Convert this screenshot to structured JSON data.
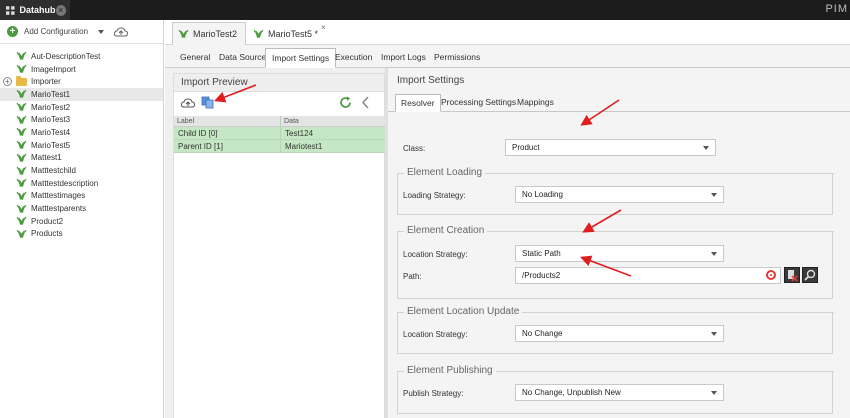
{
  "topbar": {
    "app_title": "Datahub",
    "close_glyph": "×",
    "brand": "PIM"
  },
  "sidebar": {
    "add_label": "Add Configuration",
    "items": [
      {
        "label": "Aut-DescriptionTest",
        "type": "config"
      },
      {
        "label": "ImageImport",
        "type": "config"
      },
      {
        "label": "Importer",
        "type": "folder"
      },
      {
        "label": "MarioTest1",
        "type": "config",
        "selected": true
      },
      {
        "label": "MarioTest2",
        "type": "config"
      },
      {
        "label": "MarioTest3",
        "type": "config"
      },
      {
        "label": "MarioTest4",
        "type": "config"
      },
      {
        "label": "MarioTest5",
        "type": "config"
      },
      {
        "label": "Mattest1",
        "type": "config"
      },
      {
        "label": "Matttestchild",
        "type": "config"
      },
      {
        "label": "Matttestdescription",
        "type": "config"
      },
      {
        "label": "Matttestimages",
        "type": "config"
      },
      {
        "label": "Matttestparents",
        "type": "config"
      },
      {
        "label": "Product2",
        "type": "config"
      },
      {
        "label": "Products",
        "type": "config"
      }
    ]
  },
  "doc_tabs": [
    {
      "label": "MarioTest2",
      "active": true
    },
    {
      "label": "MarioTest5 *",
      "active": false,
      "close": "×"
    }
  ],
  "sub_tabs": [
    "General",
    "Data Source",
    "Import Settings",
    "Execution",
    "Import Logs",
    "Permissions"
  ],
  "preview": {
    "title": "Import Preview",
    "columns": [
      "Label",
      "Data"
    ],
    "rows": [
      {
        "label": "Child ID [0]",
        "data": "Test124"
      },
      {
        "label": "Parent ID [1]",
        "data": "Mariotest1"
      }
    ]
  },
  "settings": {
    "title": "Import Settings",
    "tabs": [
      "Resolver",
      "Processing Settings",
      "Mappings"
    ],
    "class_label": "Class:",
    "class_value": "Product",
    "loading": {
      "title": "Element Loading",
      "label": "Loading Strategy:",
      "value": "No Loading"
    },
    "creation": {
      "title": "Element Creation",
      "location_label": "Location Strategy:",
      "location_value": "Static Path",
      "path_label": "Path:",
      "path_value": "/Products2"
    },
    "location_update": {
      "title": "Element Location Update",
      "label": "Location Strategy:",
      "value": "No Change"
    },
    "publishing": {
      "title": "Element Publishing",
      "label": "Publish Strategy:",
      "value": "No Change, Unpublish New"
    }
  },
  "colors": {
    "accent_green": "#4a9b3c",
    "row_green": "#c6e7c3",
    "arrow_red": "#e01e1e"
  }
}
